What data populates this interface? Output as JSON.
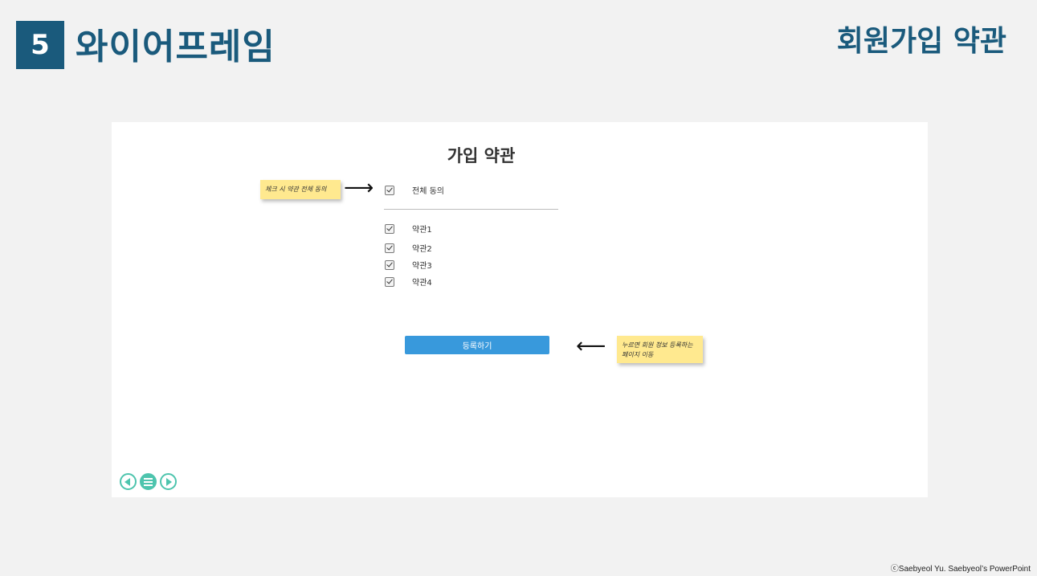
{
  "slide": {
    "section_number": "5",
    "section_title": "와이어프레임",
    "page_subject": "회원가입 약관"
  },
  "form": {
    "title": "가입 약관",
    "agree_all": {
      "label": "전체 동의",
      "checked": true
    },
    "terms": [
      {
        "label": "약관1",
        "checked": true
      },
      {
        "label": "약관2",
        "checked": true
      },
      {
        "label": "약관3",
        "checked": true
      },
      {
        "label": "약관4",
        "checked": true
      }
    ],
    "register_button": "등록하기"
  },
  "annotations": {
    "agree_all_note": "체크 시 약관 전체 동의",
    "register_note": "누르면 회원 정보 등록하는 페이지 이동",
    "arrow_right": "⟶",
    "arrow_left": "⟵"
  },
  "nav": {
    "accent_color": "#4dc4ad",
    "icons": [
      "prev-icon",
      "menu-icon",
      "next-icon"
    ]
  },
  "footer": {
    "copyright": "ⓒSaebyeol Yu. Saebyeol’s PowerPoint"
  },
  "colors": {
    "brand": "#1a5a7c",
    "button": "#3899dc",
    "sticky": "#ffe98f"
  }
}
